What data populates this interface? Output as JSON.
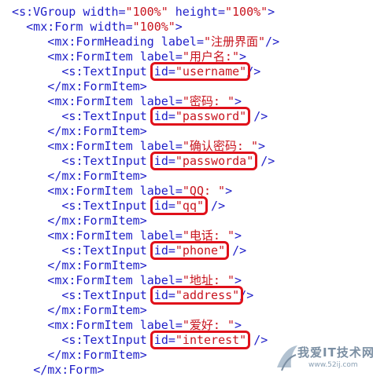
{
  "lines": [
    {
      "indent": 1,
      "parts": [
        {
          "c": "tag",
          "t": "<s:VGroup "
        },
        {
          "c": "attr",
          "t": "width="
        },
        {
          "c": "str",
          "t": "\"100%\""
        },
        {
          "c": "attr",
          "t": " height="
        },
        {
          "c": "str",
          "t": "\"100%\""
        },
        {
          "c": "tag",
          "t": ">"
        }
      ]
    },
    {
      "indent": 3,
      "parts": [
        {
          "c": "tag",
          "t": "<mx:Form "
        },
        {
          "c": "attr",
          "t": "width="
        },
        {
          "c": "str",
          "t": "\"100%\""
        },
        {
          "c": "tag",
          "t": ">"
        }
      ]
    },
    {
      "indent": 6,
      "parts": [
        {
          "c": "tag",
          "t": "<mx:FormHeading "
        },
        {
          "c": "attr",
          "t": "label="
        },
        {
          "c": "str",
          "t": "\"注册界面\""
        },
        {
          "c": "tag",
          "t": "/>"
        }
      ]
    },
    {
      "indent": 6,
      "parts": [
        {
          "c": "tag",
          "t": "<mx:FormItem "
        },
        {
          "c": "attr",
          "t": "label="
        },
        {
          "c": "str",
          "t": "\"用户名:\""
        },
        {
          "c": "tag",
          "t": ">"
        }
      ]
    },
    {
      "indent": 8,
      "parts": [
        {
          "c": "tag",
          "t": "<s:TextInput "
        },
        {
          "c": "attr",
          "t": "id="
        },
        {
          "c": "str",
          "t": "\"username\""
        },
        {
          "c": "tag",
          "t": "/>"
        }
      ]
    },
    {
      "indent": 6,
      "parts": [
        {
          "c": "tag",
          "t": "</mx:FormItem>"
        }
      ]
    },
    {
      "indent": 6,
      "parts": [
        {
          "c": "tag",
          "t": "<mx:FormItem "
        },
        {
          "c": "attr",
          "t": "label="
        },
        {
          "c": "str",
          "t": "\"密码: \""
        },
        {
          "c": "tag",
          "t": ">"
        }
      ]
    },
    {
      "indent": 8,
      "parts": [
        {
          "c": "tag",
          "t": "<s:TextInput "
        },
        {
          "c": "attr",
          "t": "id="
        },
        {
          "c": "str",
          "t": "\"password\""
        },
        {
          "c": "tag",
          "t": " />"
        }
      ]
    },
    {
      "indent": 6,
      "parts": [
        {
          "c": "tag",
          "t": "</mx:FormItem>"
        }
      ]
    },
    {
      "indent": 6,
      "parts": [
        {
          "c": "tag",
          "t": "<mx:FormItem "
        },
        {
          "c": "attr",
          "t": "label="
        },
        {
          "c": "str",
          "t": "\"确认密码: \""
        },
        {
          "c": "tag",
          "t": ">"
        }
      ]
    },
    {
      "indent": 8,
      "parts": [
        {
          "c": "tag",
          "t": "<s:TextInput "
        },
        {
          "c": "attr",
          "t": "id="
        },
        {
          "c": "str",
          "t": "\"passworda\""
        },
        {
          "c": "tag",
          "t": " />"
        }
      ]
    },
    {
      "indent": 6,
      "parts": [
        {
          "c": "tag",
          "t": "</mx:FormItem>"
        }
      ]
    },
    {
      "indent": 6,
      "parts": [
        {
          "c": "tag",
          "t": "<mx:FormItem "
        },
        {
          "c": "attr",
          "t": "label="
        },
        {
          "c": "str",
          "t": "\"QQ: \""
        },
        {
          "c": "tag",
          "t": ">"
        }
      ]
    },
    {
      "indent": 8,
      "parts": [
        {
          "c": "tag",
          "t": "<s:TextInput "
        },
        {
          "c": "attr",
          "t": "id="
        },
        {
          "c": "str",
          "t": "\"qq\""
        },
        {
          "c": "tag",
          "t": " />"
        }
      ]
    },
    {
      "indent": 6,
      "parts": [
        {
          "c": "tag",
          "t": "</mx:FormItem>"
        }
      ]
    },
    {
      "indent": 6,
      "parts": [
        {
          "c": "tag",
          "t": "<mx:FormItem "
        },
        {
          "c": "attr",
          "t": "label="
        },
        {
          "c": "str",
          "t": "\"电话: \""
        },
        {
          "c": "tag",
          "t": ">"
        }
      ]
    },
    {
      "indent": 8,
      "parts": [
        {
          "c": "tag",
          "t": "<s:TextInput "
        },
        {
          "c": "attr",
          "t": "id="
        },
        {
          "c": "str",
          "t": "\"phone\""
        },
        {
          "c": "tag",
          "t": " />"
        }
      ]
    },
    {
      "indent": 6,
      "parts": [
        {
          "c": "tag",
          "t": "</mx:FormItem>"
        }
      ]
    },
    {
      "indent": 6,
      "parts": [
        {
          "c": "tag",
          "t": "<mx:FormItem "
        },
        {
          "c": "attr",
          "t": "label="
        },
        {
          "c": "str",
          "t": "\"地址: \""
        },
        {
          "c": "tag",
          "t": ">"
        }
      ]
    },
    {
      "indent": 8,
      "parts": [
        {
          "c": "tag",
          "t": "<s:TextInput "
        },
        {
          "c": "attr",
          "t": "id="
        },
        {
          "c": "str",
          "t": "\"address\""
        },
        {
          "c": "tag",
          "t": "/>"
        }
      ]
    },
    {
      "indent": 6,
      "parts": [
        {
          "c": "tag",
          "t": "</mx:FormItem>"
        }
      ]
    },
    {
      "indent": 6,
      "parts": [
        {
          "c": "tag",
          "t": "<mx:FormItem "
        },
        {
          "c": "attr",
          "t": "label="
        },
        {
          "c": "str",
          "t": "\"爱好: \""
        },
        {
          "c": "tag",
          "t": ">"
        }
      ]
    },
    {
      "indent": 8,
      "parts": [
        {
          "c": "tag",
          "t": "<s:TextInput "
        },
        {
          "c": "attr",
          "t": "id="
        },
        {
          "c": "str",
          "t": "\"interest\""
        },
        {
          "c": "tag",
          "t": " />"
        }
      ]
    },
    {
      "indent": 6,
      "parts": [
        {
          "c": "tag",
          "t": "</mx:FormItem>"
        }
      ]
    },
    {
      "indent": 4,
      "parts": [
        {
          "c": "tag",
          "t": "</mx:Form>"
        }
      ]
    }
  ],
  "watermark": {
    "title": "我爱IT技术网",
    "url": "www.52ij.com"
  },
  "colors": {
    "tag": "#1e1ec8",
    "string": "#c8141e",
    "highlight": "#e0101a"
  }
}
